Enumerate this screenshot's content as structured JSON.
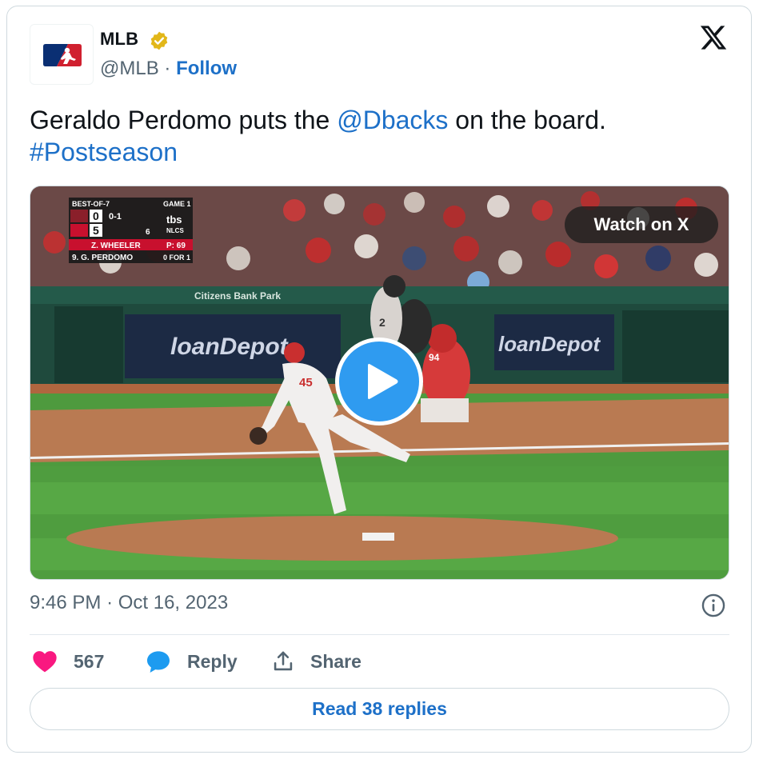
{
  "account": {
    "display_name": "MLB",
    "handle": "@MLB",
    "separator": "·",
    "follow_label": "Follow",
    "verified_icon": "verified-badge-icon",
    "avatar_icon": "mlb-logo-icon"
  },
  "tweet": {
    "text_before": "Geraldo Perdomo puts the ",
    "mention": "@Dbacks",
    "text_after": " on the board.",
    "hashtag": "#Postseason"
  },
  "media": {
    "watch_label": "Watch on X",
    "play_icon": "play-icon",
    "scorebug": {
      "series": "BEST-OF-7",
      "game": "GAME 1",
      "away_score": "0",
      "home_score": "5",
      "count": "0-1",
      "inning": "6",
      "network": "tbs",
      "round": "NLCS",
      "pitcher": "Z. WHEELER",
      "pitch_count": "P: 69",
      "batter": "9. G. PERDOMO",
      "batter_stat": "0 FOR 1"
    },
    "signage": {
      "stadium": "Citizens Bank Park",
      "sponsor_left": "loanDepot",
      "sponsor_right": "loanDepot",
      "jersey_pitcher": "45",
      "jersey_batter": "2",
      "jersey_catcher": "94"
    }
  },
  "meta": {
    "time": "9:46 PM",
    "separator": "·",
    "date": "Oct 16, 2023"
  },
  "actions": {
    "like_count": "567",
    "reply_label": "Reply",
    "share_label": "Share",
    "read_replies_label": "Read 38 replies"
  },
  "colors": {
    "link": "#1d70c8",
    "like": "#f91880",
    "reply_icon": "#1d9bf0",
    "play_button": "#2f9bf0"
  }
}
